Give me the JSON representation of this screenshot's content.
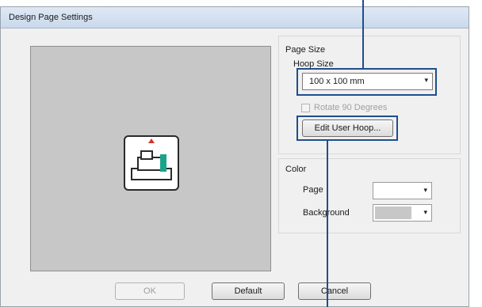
{
  "window": {
    "title": "Design Page Settings"
  },
  "page_size": {
    "group_label": "Page Size",
    "hoop_size_label": "Hoop Size",
    "hoop_size_value": "100 x 100 mm",
    "rotate_label": "Rotate 90 Degrees",
    "edit_user_hoop_button": "Edit User Hoop..."
  },
  "color": {
    "group_label": "Color",
    "page_label": "Page",
    "background_label": "Background",
    "page_color": "#ffffff",
    "background_color": "#c7c7c7"
  },
  "buttons": {
    "ok": "OK",
    "default": "Default",
    "cancel": "Cancel"
  },
  "icons": {
    "dropdown": "▾"
  }
}
